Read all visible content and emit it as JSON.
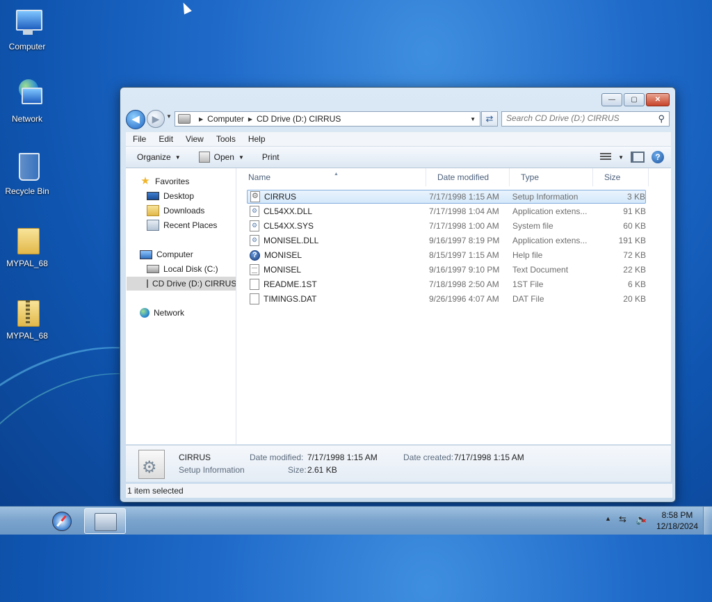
{
  "desktop": {
    "icons": [
      {
        "label": "Computer"
      },
      {
        "label": "Network"
      },
      {
        "label": "Recycle Bin"
      },
      {
        "label": "MYPAL_68"
      },
      {
        "label": "MYPAL_68"
      }
    ]
  },
  "window": {
    "controls": {
      "minimize": "—",
      "maximize": "▢",
      "close": "✕"
    },
    "address": {
      "crumbs": [
        "Computer",
        "CD Drive (D:) CIRRUS"
      ]
    },
    "search": {
      "placeholder": "Search CD Drive (D:) CIRRUS"
    },
    "menu": [
      "File",
      "Edit",
      "View",
      "Tools",
      "Help"
    ],
    "toolbar": {
      "organize": "Organize",
      "open": "Open",
      "print": "Print"
    },
    "nav_pane": {
      "favorites": "Favorites",
      "desktop": "Desktop",
      "downloads": "Downloads",
      "recent_places": "Recent Places",
      "computer": "Computer",
      "local_disk": "Local Disk (C:)",
      "cd_drive": "CD Drive (D:) CIRRUS",
      "network": "Network"
    },
    "columns": [
      "Name",
      "Date modified",
      "Type",
      "Size"
    ],
    "files": [
      {
        "name": "CIRRUS",
        "date": "7/17/1998 1:15 AM",
        "type": "Setup Information",
        "size": "3 KB",
        "icon": "setup-info-icon"
      },
      {
        "name": "CL54XX.DLL",
        "date": "7/17/1998 1:04 AM",
        "type": "Application extens...",
        "size": "91 KB",
        "icon": "dll-icon"
      },
      {
        "name": "CL54XX.SYS",
        "date": "7/17/1998 1:00 AM",
        "type": "System file",
        "size": "60 KB",
        "icon": "system-file-icon"
      },
      {
        "name": "MONISEL.DLL",
        "date": "9/16/1997 8:19 PM",
        "type": "Application extens...",
        "size": "191 KB",
        "icon": "dll-icon"
      },
      {
        "name": "MONISEL",
        "date": "8/15/1997 1:15 AM",
        "type": "Help file",
        "size": "72 KB",
        "icon": "help-file-icon"
      },
      {
        "name": "MONISEL",
        "date": "9/16/1997 9:10 PM",
        "type": "Text Document",
        "size": "22 KB",
        "icon": "text-file-icon"
      },
      {
        "name": "README.1ST",
        "date": "7/18/1998 2:50 AM",
        "type": "1ST File",
        "size": "6 KB",
        "icon": "generic-file-icon"
      },
      {
        "name": "TIMINGS.DAT",
        "date": "9/26/1996 4:07 AM",
        "type": "DAT File",
        "size": "20 KB",
        "icon": "generic-file-icon"
      }
    ],
    "details": {
      "name": "CIRRUS",
      "type": "Setup Information",
      "date_modified_label": "Date modified:",
      "date_modified": "7/17/1998 1:15 AM",
      "size_label": "Size:",
      "size": "2.61 KB",
      "date_created_label": "Date created:",
      "date_created": "7/17/1998 1:15 AM"
    },
    "status": "1 item selected"
  },
  "taskbar": {
    "time": "8:58 PM",
    "date": "12/18/2024"
  }
}
